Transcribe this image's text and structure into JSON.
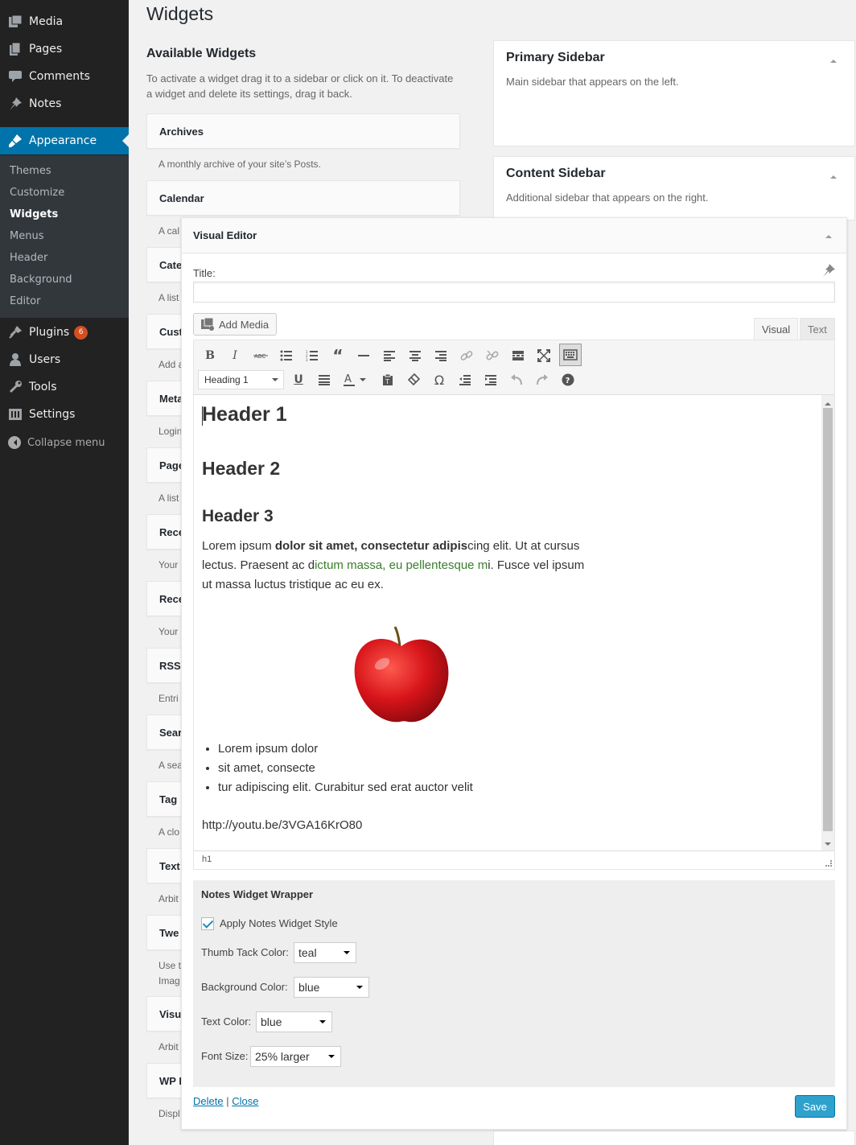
{
  "sidebar": {
    "items": [
      {
        "label": "Media",
        "icon": "media-icon"
      },
      {
        "label": "Pages",
        "icon": "pages-icon"
      },
      {
        "label": "Comments",
        "icon": "comments-icon"
      },
      {
        "label": "Notes",
        "icon": "pin-icon"
      },
      {
        "label": "Appearance",
        "icon": "brush-icon"
      },
      {
        "label": "Plugins",
        "icon": "plugin-icon",
        "badge": "6"
      },
      {
        "label": "Users",
        "icon": "users-icon"
      },
      {
        "label": "Tools",
        "icon": "wrench-icon"
      },
      {
        "label": "Settings",
        "icon": "settings-icon"
      }
    ],
    "submenu": [
      "Themes",
      "Customize",
      "Widgets",
      "Menus",
      "Header",
      "Background",
      "Editor"
    ],
    "collapse_label": "Collapse menu",
    "accent_color": "#0073aa"
  },
  "page_title": "Widgets",
  "available": {
    "title": "Available Widgets",
    "description": "To activate a widget drag it to a sidebar or click on it. To deactivate a widget and delete its settings, drag it back.",
    "widgets": [
      {
        "name": "Archives",
        "desc": "A monthly archive of your site’s Posts."
      },
      {
        "name": "Calendar",
        "desc": "A cal"
      },
      {
        "name": "Cate",
        "desc": "A list"
      },
      {
        "name": "Cust",
        "desc": "Add a"
      },
      {
        "name": "Meta",
        "desc": "Login"
      },
      {
        "name": "Page",
        "desc": "A list"
      },
      {
        "name": "Rece",
        "desc": "Your"
      },
      {
        "name": "Rece",
        "desc": "Your"
      },
      {
        "name": "RSS",
        "desc": "Entri"
      },
      {
        "name": "Sear",
        "desc": "A sea"
      },
      {
        "name": "Tag",
        "desc": "A clo"
      },
      {
        "name": "Text",
        "desc": "Arbit"
      },
      {
        "name": "Twe",
        "desc": "Use t",
        "desc2": "Imag"
      },
      {
        "name": "Visu",
        "desc": "Arbit"
      },
      {
        "name": "WP I",
        "desc": "Displ"
      }
    ]
  },
  "sidebars": [
    {
      "title": "Primary Sidebar",
      "desc": "Main sidebar that appears on the left."
    },
    {
      "title": "Content Sidebar",
      "desc": "Additional sidebar that appears on the right."
    }
  ],
  "editor_widget": {
    "title": "Visual Editor",
    "title_label": "Title:",
    "title_value": "",
    "add_media_label": "Add Media",
    "tab_visual": "Visual",
    "tab_text": "Text",
    "format_select": "Heading 1",
    "content": {
      "h1": "Header 1",
      "h2": "Header 2",
      "h3": "Header 3",
      "para_1": "Lorem ipsum ",
      "para_bold": "dolor sit amet, consectetur adipis",
      "para_2": "cing elit. Ut at cursus lectus. Praesent ac d",
      "para_green": "ictum massa, eu pellentesque m",
      "para_3": "i. Fusce vel ipsum ut massa luctus tristique ac eu ex.",
      "list": [
        "Lorem ipsum dolor",
        "sit amet, consecte",
        "tur adipiscing elit. Curabitur sed erat auctor velit"
      ],
      "url": "http://youtu.be/3VGA16KrO80"
    },
    "status_path": "h1"
  },
  "notes_wrapper": {
    "title": "Notes Widget Wrapper",
    "apply_label": "Apply Notes Widget Style",
    "apply_checked": true,
    "thumb_label": "Thumb Tack Color:",
    "thumb_value": "teal",
    "bg_label": "Background Color:",
    "bg_value": "blue",
    "text_label": "Text Color:",
    "text_value": "blue",
    "font_label": "Font Size:",
    "font_value": "25% larger"
  },
  "actions": {
    "delete": "Delete",
    "separator": "|",
    "close": "Close",
    "save": "Save"
  }
}
